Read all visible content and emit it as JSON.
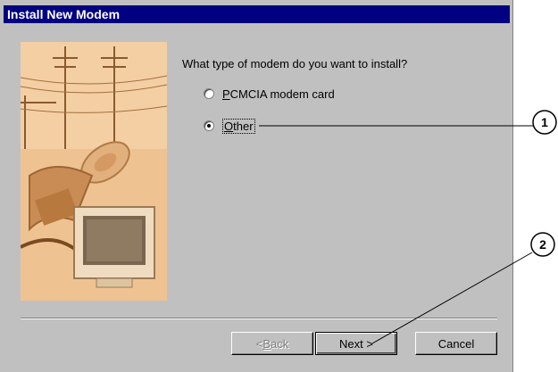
{
  "window": {
    "title": "Install New Modem"
  },
  "prompt": "What type of modem do you want to install?",
  "options": [
    {
      "label_accel": "P",
      "label_rest": "CMCIA modem card",
      "checked": false
    },
    {
      "label_accel": "O",
      "label_rest": "ther",
      "checked": true
    }
  ],
  "buttons": {
    "back_accel": "< ",
    "back_ul": "B",
    "back_rest": "ack",
    "next": "Next >",
    "cancel": "Cancel"
  },
  "callouts": [
    "1",
    "2"
  ],
  "colors": {
    "titlebar": "#000080",
    "dialog": "#c0c0c0",
    "illustration": "#efc292"
  }
}
